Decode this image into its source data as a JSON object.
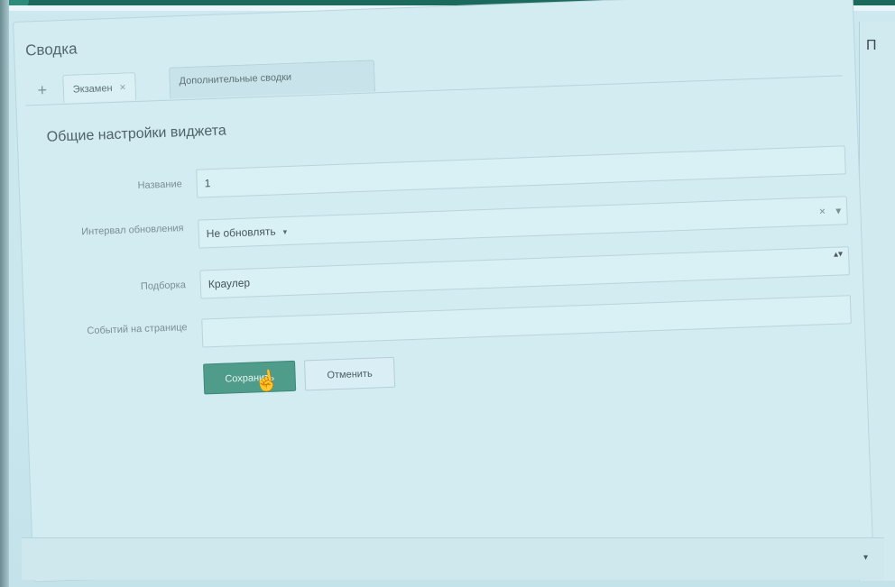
{
  "panel": {
    "title": "Сводка"
  },
  "tabs": [
    {
      "label": "Экзамен",
      "closable": true,
      "active": true
    },
    {
      "label": "Дополнительные сводки",
      "closable": false,
      "active": false
    }
  ],
  "tab_add_label": "+",
  "section": {
    "title": "Общие настройки виджета"
  },
  "form": {
    "name_label": "Название",
    "name_value": "1",
    "interval_label": "Интервал обновления",
    "interval_value": "Не обновлять",
    "collection_label": "Подборка",
    "collection_value": "Краулер",
    "events_label": "Событий на странице",
    "events_value": ""
  },
  "buttons": {
    "save": "Сохранить",
    "cancel": "Отменить"
  },
  "right_panel": {
    "title_partial": "П"
  },
  "icons": {
    "close": "×",
    "caret_down": "▾",
    "spinner": "▴▾",
    "cursor": "hand-pointer"
  },
  "colors": {
    "accent": "#4f9c8b",
    "header": "#1b6a5c"
  }
}
